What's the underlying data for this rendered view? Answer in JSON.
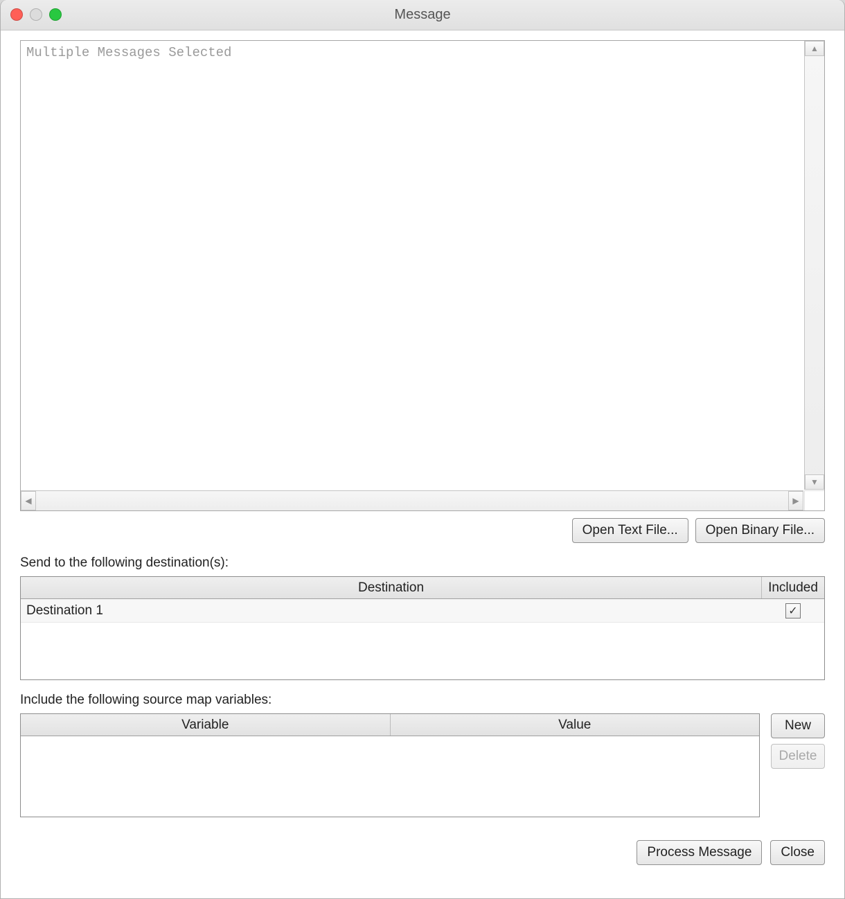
{
  "window": {
    "title": "Message"
  },
  "message_area": {
    "text": "Multiple Messages Selected"
  },
  "file_buttons": {
    "open_text": "Open Text File...",
    "open_binary": "Open Binary File..."
  },
  "destinations": {
    "section_label": "Send to the following destination(s):",
    "columns": {
      "destination": "Destination",
      "included": "Included"
    },
    "rows": [
      {
        "name": "Destination 1",
        "included": true
      }
    ]
  },
  "variables": {
    "section_label": "Include the following source map variables:",
    "columns": {
      "variable": "Variable",
      "value": "Value"
    },
    "rows": [],
    "buttons": {
      "new": "New",
      "delete": "Delete"
    }
  },
  "footer": {
    "process": "Process Message",
    "close": "Close"
  }
}
